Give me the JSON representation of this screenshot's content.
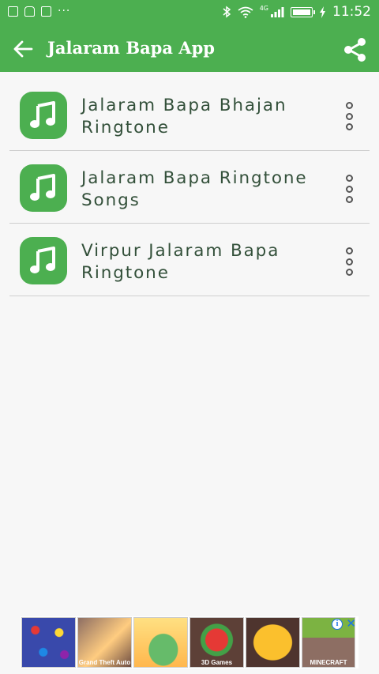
{
  "status_bar": {
    "time": "11:52",
    "dots": "···",
    "network_label": "4G"
  },
  "app_bar": {
    "title": "Jalaram Bapa App"
  },
  "items": [
    {
      "title": "Jalaram Bapa Bhajan Ringtone"
    },
    {
      "title": "Jalaram Bapa Ringtone Songs"
    },
    {
      "title": "Virpur Jalaram Bapa Ringtone"
    }
  ],
  "ad": {
    "info_label": "i",
    "close_label": "✕",
    "tiles": [
      {
        "caption": ""
      },
      {
        "caption": "Grand Theft Auto"
      },
      {
        "caption": ""
      },
      {
        "caption": "3D Games"
      },
      {
        "caption": ""
      },
      {
        "caption": "MINECRAFT"
      }
    ]
  },
  "colors": {
    "primary": "#4caf50",
    "title_text": "#33503a",
    "background": "#f7f7f7"
  }
}
